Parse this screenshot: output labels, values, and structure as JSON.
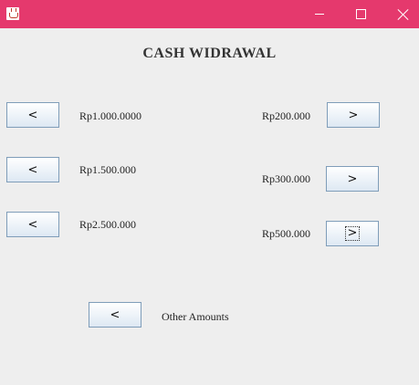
{
  "window": {
    "controls": {
      "minimize_icon": "minimize-icon",
      "maximize_icon": "maximize-icon",
      "close_icon": "close-icon"
    }
  },
  "title": "CASH WIDRAWAL",
  "left_buttons": [
    {
      "label": "<",
      "amount": "Rp1.000.0000"
    },
    {
      "label": "<",
      "amount": "Rp1.500.000"
    },
    {
      "label": "<",
      "amount": "Rp2.500.000"
    }
  ],
  "right_buttons": [
    {
      "label": ">",
      "amount": "Rp200.000"
    },
    {
      "label": ">",
      "amount": "Rp300.000"
    },
    {
      "label": ">",
      "amount": "Rp500.000",
      "focused": true
    }
  ],
  "other": {
    "label": "<",
    "text": "Other Amounts"
  }
}
